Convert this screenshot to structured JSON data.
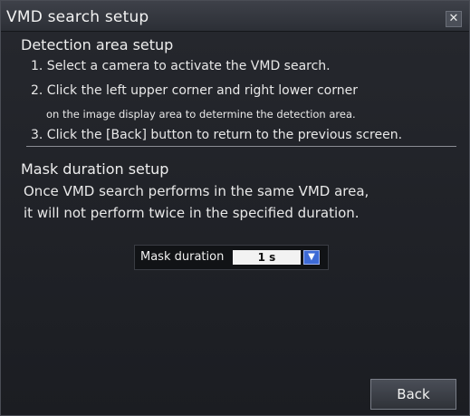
{
  "window": {
    "title": "VMD search setup",
    "close_icon": "close-icon"
  },
  "detection": {
    "heading": "Detection area setup",
    "step1": "1. Select a camera to activate the VMD search.",
    "step2": "2. Click the left upper corner and right lower corner",
    "step2b": "on the image display area to determine the detection area.",
    "step3": "3. Click the [Back] button to return to the previous screen."
  },
  "mask": {
    "heading": "Mask duration setup",
    "line1": "Once VMD search performs in the same VMD area,",
    "line2": "it will not perform twice in the specified duration.",
    "label": "Mask duration",
    "value": "1 s",
    "dropdown_icon": "chevron-down-icon"
  },
  "footer": {
    "back_label": "Back"
  },
  "colors": {
    "titlebar": "#3e4149",
    "background": "#1f2126",
    "dropdown_accent": "#3d6ad6"
  }
}
